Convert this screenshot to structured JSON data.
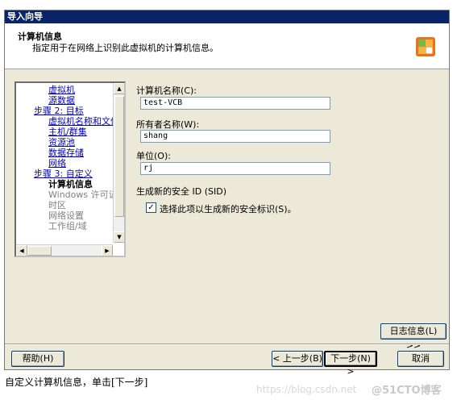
{
  "window": {
    "title": "导入向导"
  },
  "header": {
    "title": "计算机信息",
    "subtitle": "指定用于在网络上识别此虚拟机的计算机信息。"
  },
  "nav": {
    "items": [
      {
        "label": "虚拟机",
        "style": "link"
      },
      {
        "label": "源数据",
        "style": "link"
      },
      {
        "label": "步骤 2: 目标",
        "style": "link"
      },
      {
        "label": "虚拟机名称和文件",
        "style": "link"
      },
      {
        "label": "主机/群集",
        "style": "link"
      },
      {
        "label": "资源池",
        "style": "link"
      },
      {
        "label": "数据存储",
        "style": "link"
      },
      {
        "label": "网络",
        "style": "link"
      },
      {
        "label": "步骤 3: 自定义",
        "style": "link"
      },
      {
        "label": "计算机信息",
        "style": "bold"
      },
      {
        "label": "Windows 许可证",
        "style": "gray"
      },
      {
        "label": "时区",
        "style": "gray"
      },
      {
        "label": "网络设置",
        "style": "gray"
      },
      {
        "label": "工作组/域",
        "style": "gray"
      }
    ]
  },
  "form": {
    "computer_name": {
      "label": "计算机名称(C):",
      "value": "test-VCB"
    },
    "owner_name": {
      "label": "所有者名称(W):",
      "value": "shang"
    },
    "organization": {
      "label": "单位(O):",
      "value": "rj"
    },
    "sid": {
      "section_label": "生成新的安全 ID (SID)",
      "checkbox_label": "选择此项以生成新的安全标识(S)。",
      "checked": true,
      "check_glyph": "✓"
    }
  },
  "buttons": {
    "log": "日志信息(L) >>",
    "help": "帮助(H)",
    "back": "< 上一步(B)",
    "next": "下一步(N) >",
    "cancel": "取消"
  },
  "caption": "自定义计算机信息，单击[下一步]",
  "watermark": "https://blog.csdn.net",
  "watermark_logo": "@51CTO博客",
  "icons": [
    "wizard-logo-icon",
    "arrow-up-icon",
    "arrow-down-icon",
    "arrow-left-icon",
    "arrow-right-icon"
  ]
}
